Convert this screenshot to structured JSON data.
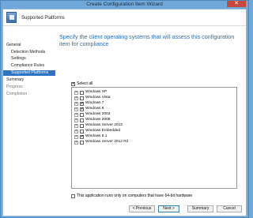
{
  "window": {
    "title": "Create Configuration Item Wizard",
    "close_glyph": "✕"
  },
  "header": {
    "title": "Supported Platforms",
    "icon": "wizard-icon"
  },
  "sidebar": {
    "items": [
      {
        "label": "General",
        "level": 0,
        "state": "normal"
      },
      {
        "label": "Detection Methods",
        "level": 1,
        "state": "normal"
      },
      {
        "label": "Settings",
        "level": 1,
        "state": "normal"
      },
      {
        "label": "Compliance Rules",
        "level": 1,
        "state": "normal"
      },
      {
        "label": "Supported Platforms",
        "level": 1,
        "state": "active"
      },
      {
        "label": "Summary",
        "level": 0,
        "state": "normal"
      },
      {
        "label": "Progress",
        "level": 0,
        "state": "muted"
      },
      {
        "label": "Completion",
        "level": 0,
        "state": "muted"
      }
    ]
  },
  "main": {
    "heading": "Specify the client operating systems that will assess this configuration item for compliance",
    "select_all": {
      "label": "Select all",
      "checked": true
    },
    "platforms": [
      {
        "label": "Windows XP",
        "checked": false
      },
      {
        "label": "Windows Vista",
        "checked": false
      },
      {
        "label": "Windows 7",
        "checked": true
      },
      {
        "label": "Windows 8",
        "checked": true
      },
      {
        "label": "Windows 2003",
        "checked": false
      },
      {
        "label": "Windows 2008",
        "checked": false
      },
      {
        "label": "Windows Server 2012",
        "checked": false
      },
      {
        "label": "Windows Embedded",
        "checked": false
      },
      {
        "label": "Windows 8.1",
        "checked": true
      },
      {
        "label": "Windows Server 2012 R2",
        "checked": false
      }
    ],
    "only_64bit": {
      "label": "This application runs only on computers that have 64-bit hardware",
      "checked": false
    }
  },
  "footer": {
    "previous": "< Previous",
    "next": "Next >",
    "summary": "Summary",
    "cancel": "Cancel"
  },
  "colors": {
    "accent": "#2e73c1",
    "heading": "#2d6db1",
    "window_bg": "#6fa7d8"
  }
}
